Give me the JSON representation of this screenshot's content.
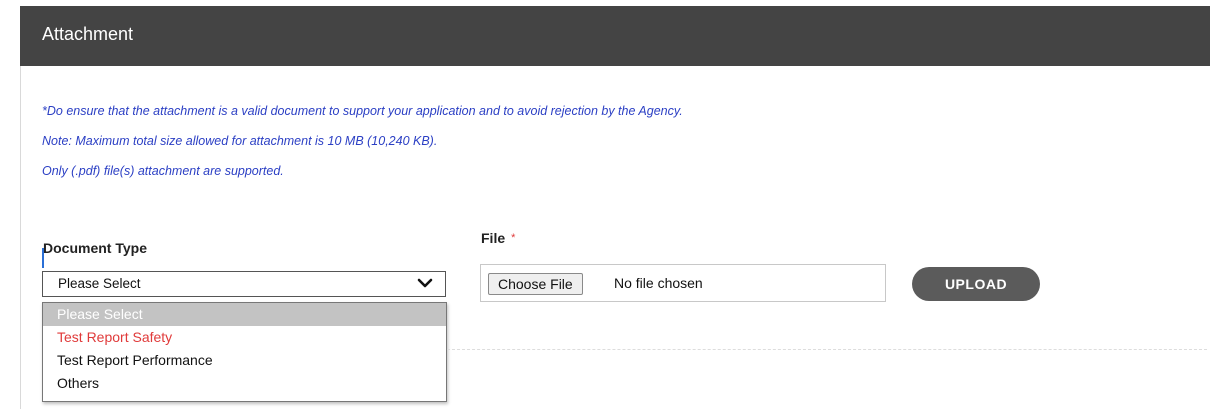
{
  "panel": {
    "title": "Attachment"
  },
  "notes": [
    "*Do ensure that the attachment is a valid document to support your application and to avoid rejection by the Agency.",
    "Note: Maximum total size allowed for attachment is 10 MB (10,240 KB).",
    "Only (.pdf) file(s) attachment are supported."
  ],
  "document_type": {
    "label": "Document Type",
    "selected_value": "Please Select",
    "options": [
      "Please Select",
      "Test Report Safety",
      "Test Report Performance",
      "Others"
    ]
  },
  "file": {
    "label": "File",
    "required_marker": "*",
    "choose_button_label": "Choose File",
    "status_text": "No file chosen"
  },
  "upload": {
    "label": "UPLOAD"
  },
  "colors": {
    "header_bg": "#444444",
    "note_text": "#2b3fc4",
    "required": "#e03a3a",
    "upload_bg": "#5b5b5b",
    "option_selected_bg": "#c3c3c3",
    "option_hover_text": "#e03a3a"
  },
  "icons": {
    "select_arrow": "chevron-down-icon"
  }
}
